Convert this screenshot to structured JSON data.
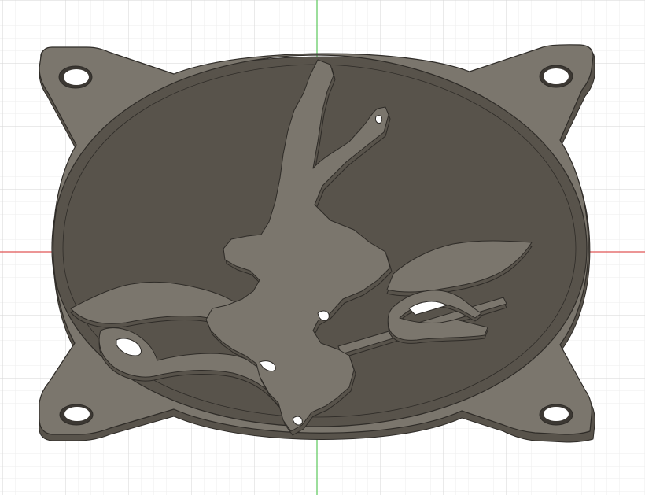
{
  "viewport": {
    "background": "#ffffff",
    "grid_minor_color": "#eeeeee",
    "grid_major_color": "#d6d6d6",
    "x_axis_color": "#e05656",
    "y_axis_color": "#5bc75b"
  },
  "model": {
    "part": "fan-grill",
    "face_color": "#7b766d",
    "side_color": "#58534b",
    "edge_color": "#2f2c28",
    "mounting_holes": 4,
    "design": "silhouette-figure-with-wings-and-trident"
  }
}
